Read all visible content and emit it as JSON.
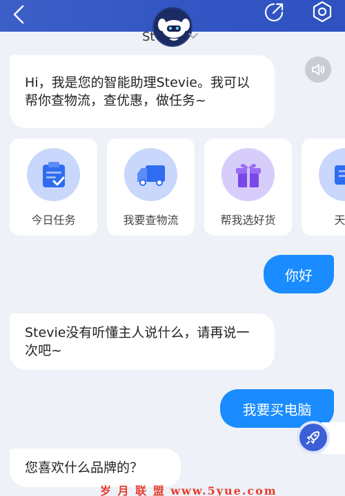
{
  "header": {
    "assistant_name": "St",
    "back_icon": "back-icon",
    "share_icon": "share-icon",
    "settings_icon": "settings-icon",
    "accent_color": "#3256c4"
  },
  "messages": [
    {
      "from": "bot",
      "text": "Hi，我是您的智能助理Stevie。我可以帮你查物流，查优惠，做任务~"
    },
    {
      "from": "user",
      "text": "你好"
    },
    {
      "from": "bot",
      "text": "Stevie没有听懂主人说什么，请再说一次吧~"
    },
    {
      "from": "user",
      "text": "我要买电脑"
    },
    {
      "from": "bot",
      "text": "您喜欢什么品牌的？"
    }
  ],
  "quick_actions": [
    {
      "label": "今日任务",
      "icon": "clipboard-check-icon"
    },
    {
      "label": "我要查物流",
      "icon": "delivery-truck-icon"
    },
    {
      "label": "帮我选好货",
      "icon": "gift-box-icon"
    },
    {
      "label": "天天",
      "icon": "coupon-icon"
    }
  ],
  "watermark": "岁 月 联 盟  www.5yue.com",
  "colors": {
    "user_bubble": "#1a8cff",
    "bot_bubble": "#ffffff",
    "background": "#eef1f7"
  }
}
